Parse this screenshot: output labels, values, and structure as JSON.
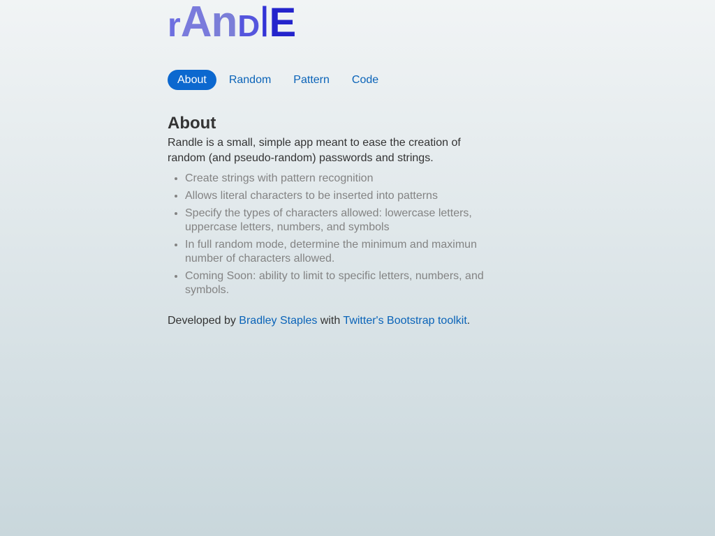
{
  "brand": {
    "letters": [
      "r",
      "A",
      "n",
      "D",
      "l",
      "E"
    ],
    "colors": [
      "#6e6fe0",
      "#7a7bdc",
      "#7b7ed8",
      "#5555dd",
      "#3333d6",
      "#2424cc"
    ]
  },
  "nav": {
    "items": [
      {
        "label": "About",
        "active": true
      },
      {
        "label": "Random",
        "active": false
      },
      {
        "label": "Pattern",
        "active": false
      },
      {
        "label": "Code",
        "active": false
      }
    ]
  },
  "about": {
    "heading": "About",
    "intro": "Randle is a small, simple app meant to ease the creation of random (and pseudo-random) passwords and strings.",
    "features": [
      "Create strings with pattern recognition",
      "Allows literal characters to be inserted into patterns",
      "Specify the types of characters allowed: lowercase letters, uppercase letters, numbers, and symbols",
      "In full random mode, determine the minimum and maximun number of characters allowed.",
      "Coming Soon: ability to limit to specific letters, numbers, and symbols."
    ]
  },
  "credits": {
    "prefix": "Developed by ",
    "author_link": "Bradley Staples",
    "middle": " with ",
    "toolkit_link": "Twitter's Bootstrap toolkit",
    "suffix": "."
  },
  "theme": {
    "accent": "#0c68cf",
    "link": "#0a63b8"
  }
}
